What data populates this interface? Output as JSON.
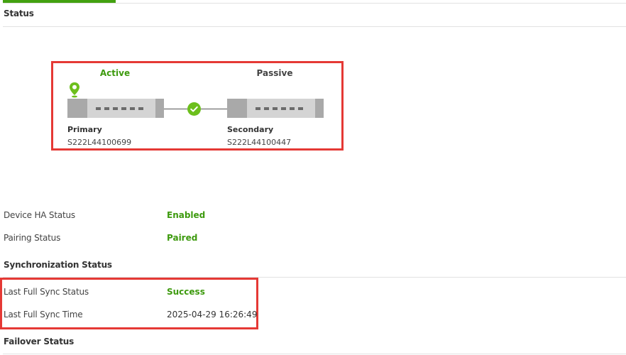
{
  "status": {
    "title": "Status",
    "diagram": {
      "primary": {
        "state": "Active",
        "role": "Primary",
        "serial": "S222L44100699"
      },
      "secondary": {
        "state": "Passive",
        "role": "Secondary",
        "serial": "S222L44100447"
      },
      "link_icon": "check-circle-icon",
      "location_icon": "location-pin-icon"
    },
    "rows": [
      {
        "label": "Device HA Status",
        "value": "Enabled"
      },
      {
        "label": "Pairing Status",
        "value": "Paired"
      }
    ]
  },
  "synchronization": {
    "title": "Synchronization Status",
    "rows": [
      {
        "label": "Last Full Sync Status",
        "value": "Success"
      },
      {
        "label": "Last Full Sync Time",
        "value": "2025-04-29 16:26:49"
      }
    ]
  },
  "failover": {
    "title": "Failover Status"
  },
  "colors": {
    "accent_green": "#3d9a0e",
    "highlight_red": "#e53935",
    "tab_indicator": "#43a110"
  }
}
